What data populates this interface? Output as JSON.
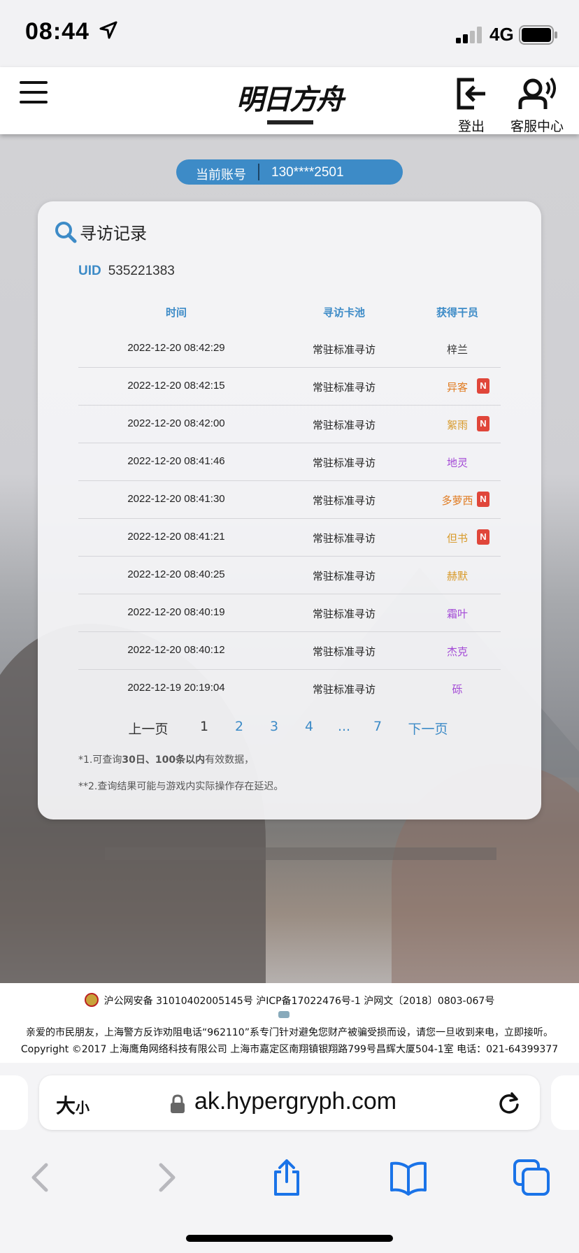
{
  "status_bar": {
    "time": "08:44",
    "network": "4G"
  },
  "header": {
    "logo_text": "明日方舟",
    "logout_label": "登出",
    "service_label": "客服中心"
  },
  "account": {
    "label": "当前账号",
    "value": "130****2501"
  },
  "card": {
    "title": "寻访记录",
    "uid_label": "UID",
    "uid_value": "535221383",
    "columns": {
      "time": "时间",
      "pool": "寻访卡池",
      "operator": "获得干员"
    },
    "rows": [
      {
        "time": "2022-12-20 08:42:29",
        "pool": "常驻标准寻访",
        "operator": "梓兰",
        "new": "",
        "color": "#333333"
      },
      {
        "time": "2022-12-20 08:42:15",
        "pool": "常驻标准寻访",
        "operator": "异客",
        "new": "N",
        "color": "#e07a1f"
      },
      {
        "time": "2022-12-20 08:42:00",
        "pool": "常驻标准寻访",
        "operator": "絮雨",
        "new": "N",
        "color": "#d89a2a"
      },
      {
        "time": "2022-12-20 08:41:46",
        "pool": "常驻标准寻访",
        "operator": "地灵",
        "new": "",
        "color": "#a349d6"
      },
      {
        "time": "2022-12-20 08:41:30",
        "pool": "常驻标准寻访",
        "operator": "多萝西",
        "new": "N",
        "color": "#e07a1f"
      },
      {
        "time": "2022-12-20 08:41:21",
        "pool": "常驻标准寻访",
        "operator": "但书",
        "new": "N",
        "color": "#d89a2a"
      },
      {
        "time": "2022-12-20 08:40:25",
        "pool": "常驻标准寻访",
        "operator": "赫默",
        "new": "",
        "color": "#d89a2a"
      },
      {
        "time": "2022-12-20 08:40:19",
        "pool": "常驻标准寻访",
        "operator": "霜叶",
        "new": "",
        "color": "#a349d6"
      },
      {
        "time": "2022-12-20 08:40:12",
        "pool": "常驻标准寻访",
        "operator": "杰克",
        "new": "",
        "color": "#a349d6"
      },
      {
        "time": "2022-12-19 20:19:04",
        "pool": "常驻标准寻访",
        "operator": "砾",
        "new": "",
        "color": "#a349d6"
      }
    ],
    "pager": {
      "prev": "上一页",
      "p1": "1",
      "p2": "2",
      "p3": "3",
      "p4": "4",
      "dots": "...",
      "p7": "7",
      "next": "下一页"
    },
    "note1": {
      "prefix": "*1.可查询",
      "bold": "30日、100条以内",
      "suffix": "有效数据，"
    },
    "note2": "**2.查询结果可能与游戏内实际操作存在延迟。"
  },
  "footer": {
    "line1": "沪公网安备 31010402005145号  沪ICP备17022476号-1  沪网文〔2018〕0803-067号",
    "line2": "亲爱的市民朋友，上海警方反诈劝阻电话“962110”系专门针对避免您财产被骗受损而设，请您一旦收到来电，立即接听。",
    "line3": "Copyright ©2017 上海鹰角网络科技有限公司  上海市嘉定区南翔镇银翔路799号昌辉大厦504-1室  电话：021-64399377"
  },
  "browser": {
    "text_size_big": "大",
    "text_size_small": "小",
    "url": "ak.hypergryph.com",
    "accent": "#1a73e8"
  }
}
